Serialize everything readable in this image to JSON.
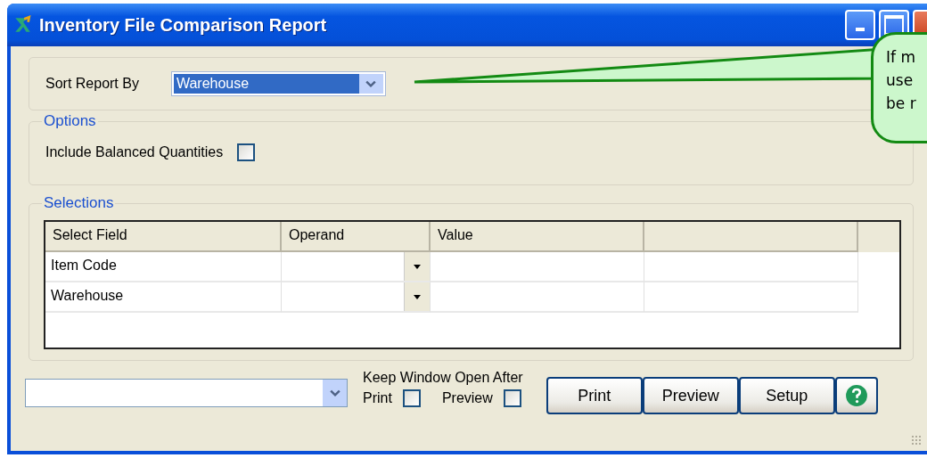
{
  "window": {
    "title": "Inventory File Comparison Report"
  },
  "sort": {
    "label": "Sort Report By",
    "value": "Warehouse"
  },
  "options": {
    "legend": "Options",
    "items": [
      {
        "label": "Include Balanced Quantities",
        "checked": false
      }
    ]
  },
  "selections": {
    "legend": "Selections",
    "columns": [
      "Select Field",
      "Operand",
      "Value"
    ],
    "rows": [
      {
        "field": "Item Code"
      },
      {
        "field": "Warehouse"
      }
    ]
  },
  "keep_open": {
    "label": "Keep Window Open After",
    "items": [
      {
        "label": "Print",
        "checked": false
      },
      {
        "label": "Preview",
        "checked": false
      }
    ]
  },
  "buttons": [
    "Print",
    "Preview",
    "Setup"
  ],
  "callout": {
    "lines": [
      "If m",
      "use",
      "be r"
    ]
  }
}
